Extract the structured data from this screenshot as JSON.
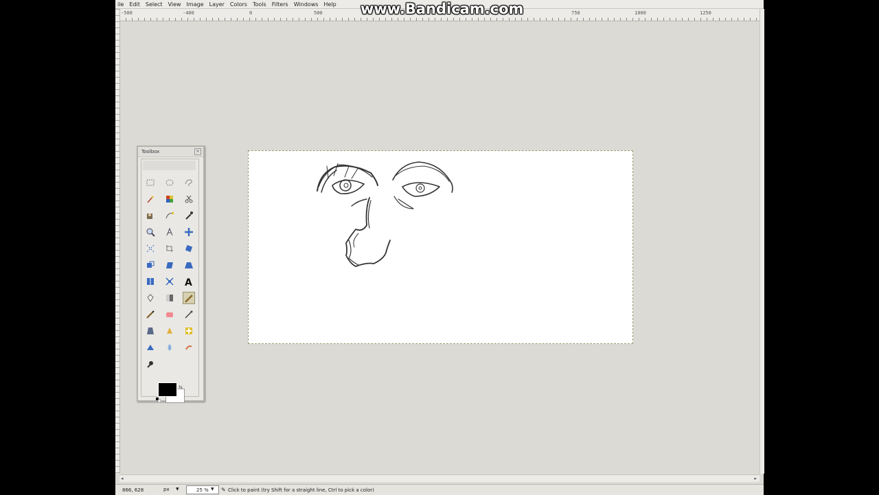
{
  "menu": [
    "ile",
    "Edit",
    "Select",
    "View",
    "Image",
    "Layer",
    "Colors",
    "Tools",
    "Filters",
    "Windows",
    "Help"
  ],
  "ruler": {
    "labels": [
      "-500",
      "-400",
      "0",
      "500",
      "750",
      "1000",
      "1250"
    ]
  },
  "watermark": "www.Bandicam.com",
  "toolbox": {
    "title": "Toolbox",
    "close": "×",
    "tools": [
      "rect-select-icon",
      "ellipse-select-icon",
      "free-select-icon",
      "fuzzy-select-icon",
      "color-select-icon",
      "scissors-icon",
      "foreground-select-icon",
      "paths-icon",
      "color-picker-icon",
      "zoom-icon",
      "measure-icon",
      "move-icon",
      "align-icon",
      "crop-icon",
      "rotate-icon",
      "scale-icon",
      "shear-icon",
      "perspective-icon",
      "flip-icon",
      "cage-icon",
      "text-icon",
      "bucket-fill-icon",
      "blend-icon",
      "pencil-icon",
      "paintbrush-icon",
      "eraser-icon",
      "airbrush-icon",
      "ink-icon",
      "clone-icon",
      "heal-icon",
      "perspective-clone-icon",
      "blur-icon",
      "smudge-icon",
      "dodge-burn-icon"
    ],
    "active_tool": "pencil-icon",
    "fg_color": "#000000",
    "bg_color": "#ffffff"
  },
  "status": {
    "coords": "866, 628",
    "unit": "px",
    "zoom": "25 %",
    "message": "Click to paint (try Shift for a straight line, Ctrl to pick a color)"
  }
}
